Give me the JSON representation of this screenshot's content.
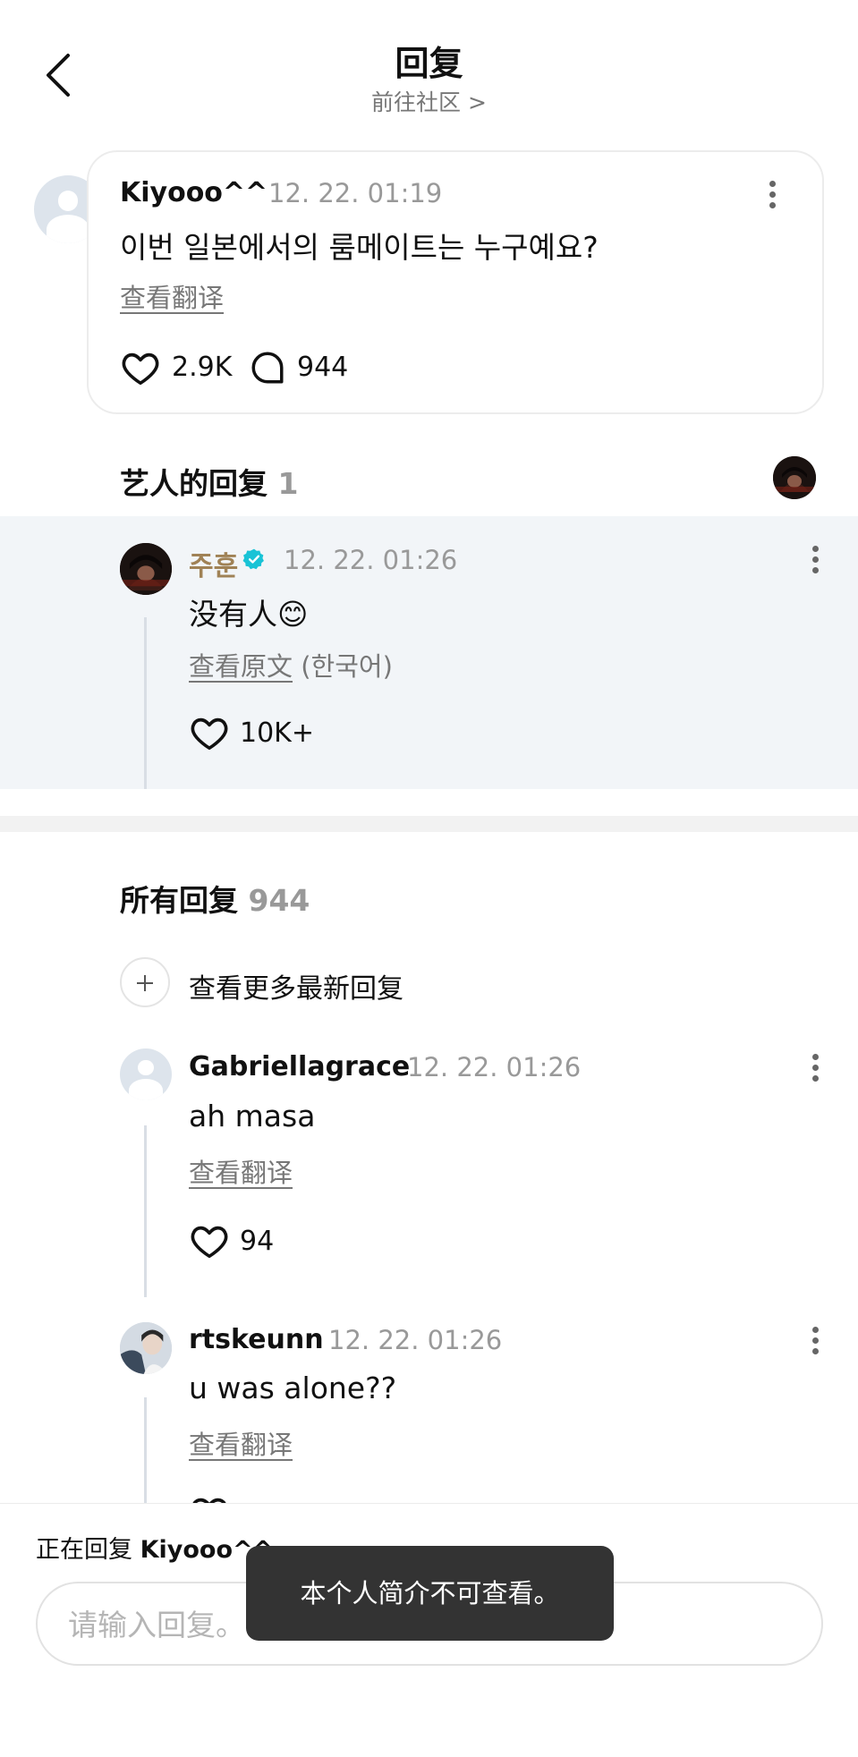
{
  "header": {
    "title": "回复",
    "subtitle": "前往社区 >"
  },
  "original_comment": {
    "username": "Kiyooo^^",
    "timestamp": "12. 22. 01:19",
    "text": "이번 일본에서의 룸메이트는 누구예요?",
    "translate_link": "查看翻译",
    "likes": "2.9K",
    "replies": "944"
  },
  "artist_section": {
    "title": "艺人的回复",
    "count": "1",
    "reply": {
      "username": "주훈",
      "timestamp": "12. 22. 01:26",
      "text": "没有人😊",
      "original_link": "查看原文",
      "original_lang": "(한국어)",
      "likes": "10K+"
    }
  },
  "all_section": {
    "title": "所有回复",
    "count": "944",
    "load_more": "查看更多最新回复",
    "replies": [
      {
        "username": "Gabriellagrace",
        "timestamp": "12. 22. 01:26",
        "text": "ah masa",
        "translate_link": "查看翻译",
        "likes": "94"
      },
      {
        "username": "rtskeunn",
        "timestamp": "12. 22. 01:26",
        "text": "u was alone??",
        "translate_link": "查看翻译"
      }
    ]
  },
  "composer": {
    "replying_prefix": "正在回复",
    "replying_to": "Kiyooo^^",
    "placeholder": "请输入回复。"
  },
  "toast": {
    "message": "本个人简介不可查看。"
  },
  "colors": {
    "artist_name": "#a08256",
    "verified": "#19c3d6",
    "artist_bg": "#f2f5f8"
  }
}
